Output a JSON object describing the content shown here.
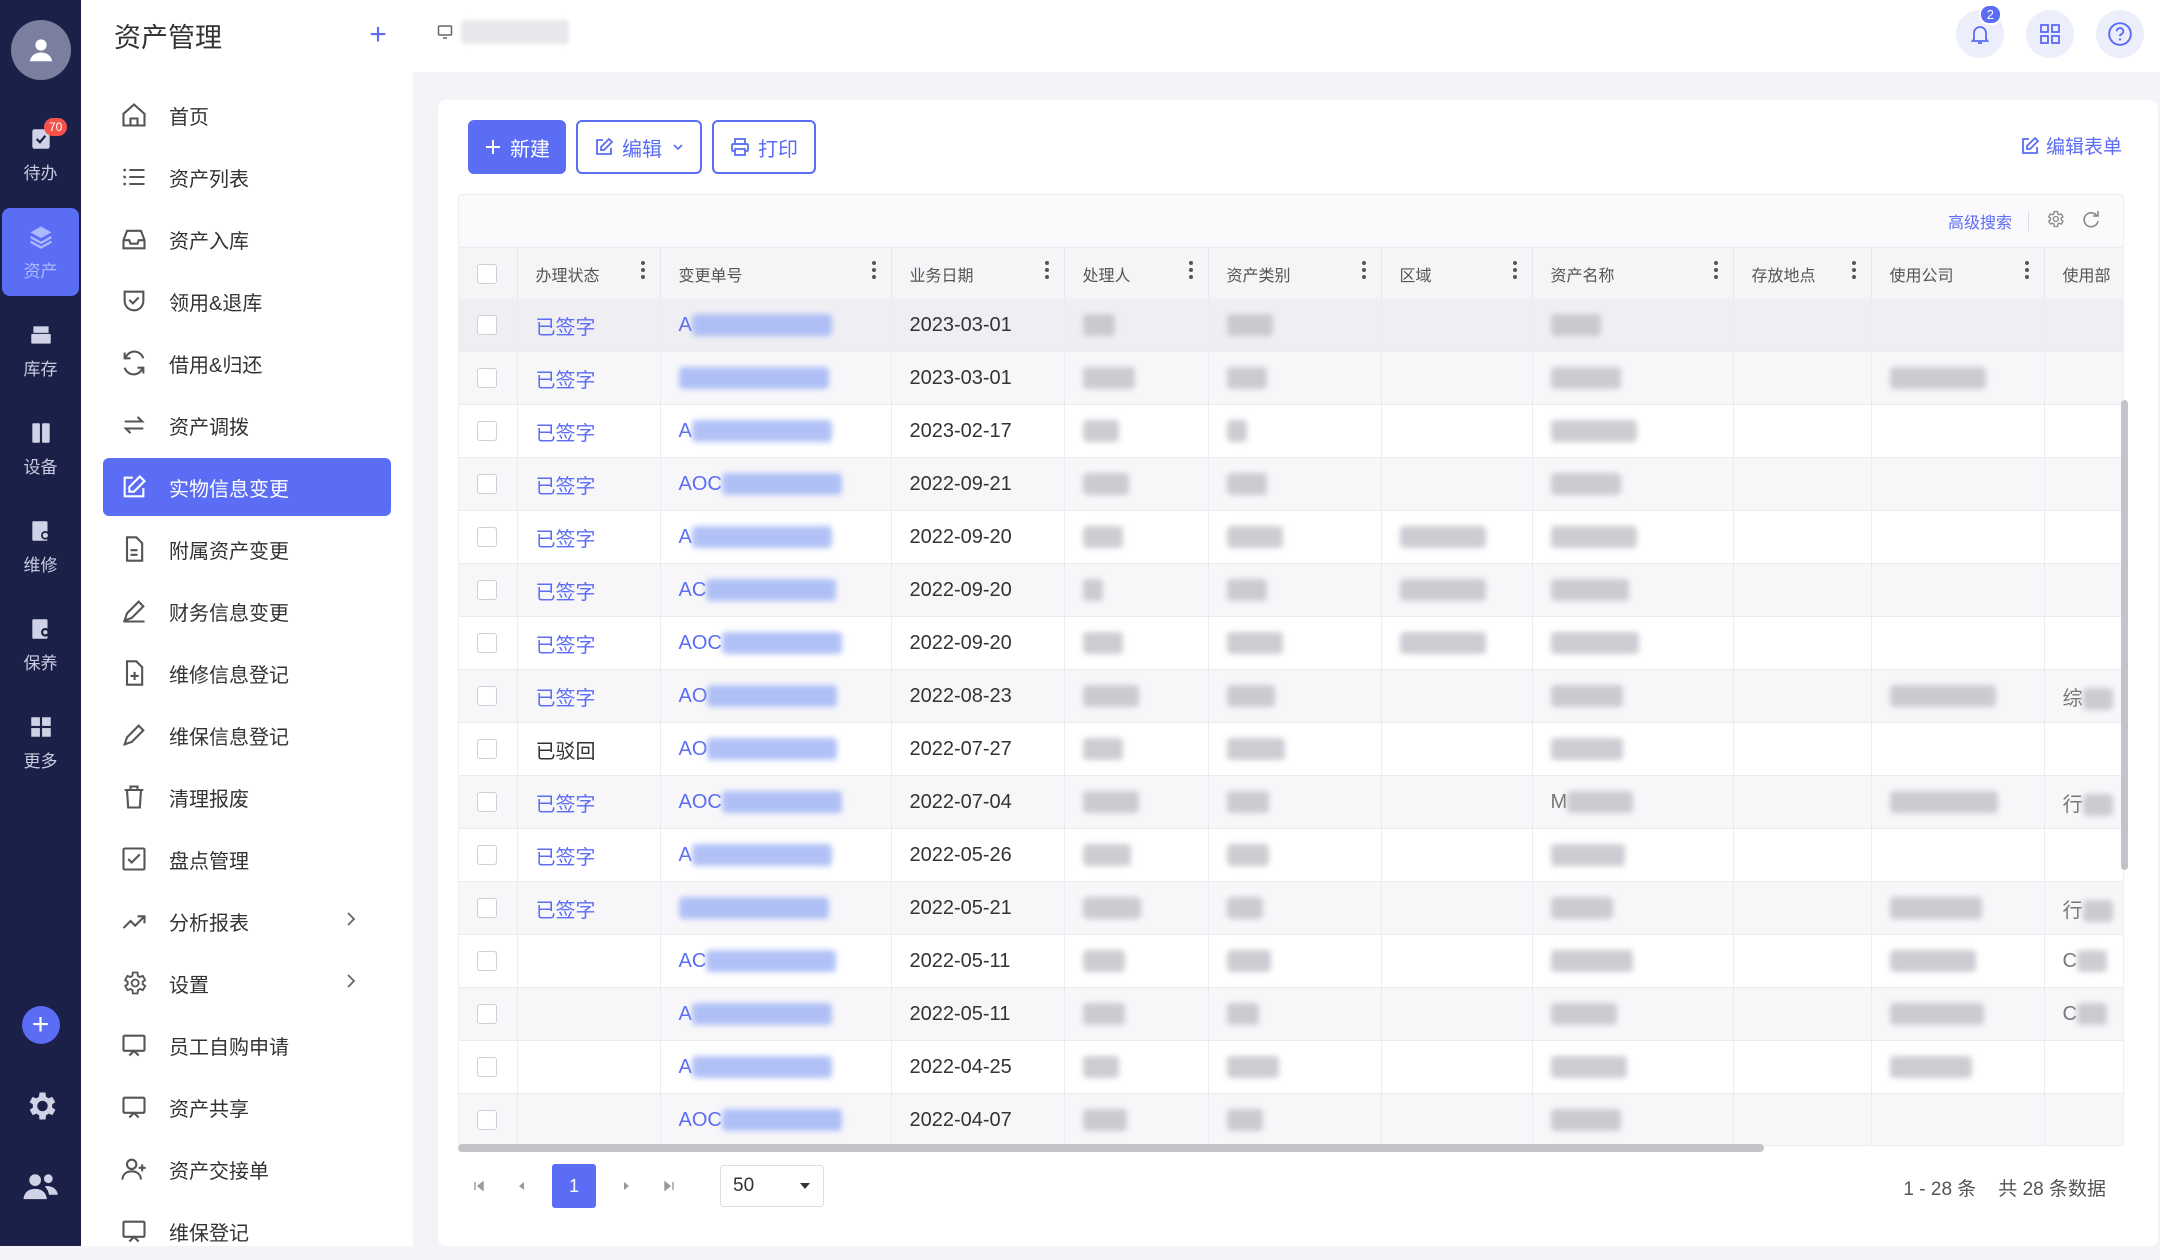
{
  "rail": {
    "items": [
      {
        "label": "待办",
        "badge": "70",
        "icon": "todo-icon"
      },
      {
        "label": "资产",
        "icon": "layers-icon",
        "active": true
      },
      {
        "label": "库存",
        "icon": "inventory-icon"
      },
      {
        "label": "设备",
        "icon": "device-icon"
      },
      {
        "label": "维修",
        "icon": "repair-icon"
      },
      {
        "label": "保养",
        "icon": "maintain-icon"
      },
      {
        "label": "更多",
        "icon": "grid-icon"
      }
    ]
  },
  "sidebar": {
    "title": "资产管理",
    "items": [
      {
        "label": "首页",
        "icon": "home-icon"
      },
      {
        "label": "资产列表",
        "icon": "list-icon"
      },
      {
        "label": "资产入库",
        "icon": "inbox-icon"
      },
      {
        "label": "领用&退库",
        "icon": "shield-check-icon"
      },
      {
        "label": "借用&归还",
        "icon": "refresh-icon"
      },
      {
        "label": "资产调拨",
        "icon": "transfer-icon"
      },
      {
        "label": "实物信息变更",
        "icon": "edit-icon",
        "active": true
      },
      {
        "label": "附属资产变更",
        "icon": "file-icon"
      },
      {
        "label": "财务信息变更",
        "icon": "pen-icon"
      },
      {
        "label": "维修信息登记",
        "icon": "file-plus-icon"
      },
      {
        "label": "维保信息登记",
        "icon": "pencil-icon"
      },
      {
        "label": "清理报废",
        "icon": "trash-icon"
      },
      {
        "label": "盘点管理",
        "icon": "checkbox-icon"
      },
      {
        "label": "分析报表",
        "icon": "trend-icon",
        "expandable": true
      },
      {
        "label": "设置",
        "icon": "gear-icon",
        "expandable": true
      },
      {
        "label": "员工自购申请",
        "icon": "monitor-icon"
      },
      {
        "label": "资产共享",
        "icon": "share-screen-icon"
      },
      {
        "label": "资产交接单",
        "icon": "user-plus-icon"
      },
      {
        "label": "维保登记",
        "icon": "register-icon"
      }
    ]
  },
  "topbar": {
    "notification_count": "2"
  },
  "toolbar": {
    "new_label": "新建",
    "edit_label": "编辑",
    "print_label": "打印",
    "edit_form_label": "编辑表单"
  },
  "table_tools": {
    "advanced_search": "高级搜索"
  },
  "table": {
    "columns": [
      "办理状态",
      "变更单号",
      "业务日期",
      "处理人",
      "资产类别",
      "区域",
      "资产名称",
      "存放地点",
      "使用公司",
      "使用部"
    ],
    "rows": [
      {
        "status": "已签字",
        "doc_prefix": "A",
        "date": "2023-03-01"
      },
      {
        "status": "已签字",
        "doc_prefix": "",
        "date": "2023-03-01"
      },
      {
        "status": "已签字",
        "doc_prefix": "A",
        "date": "2023-02-17"
      },
      {
        "status": "已签字",
        "doc_prefix": "AOC",
        "date": "2022-09-21"
      },
      {
        "status": "已签字",
        "doc_prefix": "A",
        "date": "2022-09-20"
      },
      {
        "status": "已签字",
        "doc_prefix": "AC",
        "date": "2022-09-20"
      },
      {
        "status": "已签字",
        "doc_prefix": "AOC",
        "date": "2022-09-20"
      },
      {
        "status": "已签字",
        "doc_prefix": "AO",
        "date": "2022-08-23"
      },
      {
        "status": "已驳回",
        "doc_prefix": "AO",
        "date": "2022-07-27"
      },
      {
        "status": "已签字",
        "doc_prefix": "AOC",
        "date": "2022-07-04"
      },
      {
        "status": "已签字",
        "doc_prefix": "A",
        "date": "2022-05-26"
      },
      {
        "status": "已签字",
        "doc_prefix": "",
        "date": "2022-05-21"
      },
      {
        "status": "",
        "doc_prefix": "AC",
        "date": "2022-05-11"
      },
      {
        "status": "",
        "doc_prefix": "A",
        "date": "2022-05-11"
      },
      {
        "status": "",
        "doc_prefix": "A",
        "date": "2022-04-25"
      },
      {
        "status": "",
        "doc_prefix": "AOC",
        "date": "2022-04-07"
      }
    ],
    "name_partials": {
      "9": "M"
    },
    "dept_partials": {
      "7": "综",
      "9": "行",
      "11": "行",
      "12": "C",
      "13": "C"
    }
  },
  "pager": {
    "current_page": "1",
    "page_size": "50",
    "range": "1 - 28 条",
    "total": "共 28 条数据"
  },
  "colors": {
    "accent": "#5b6cf5",
    "rail_bg": "#1b2049",
    "badge_red": "#f5524a"
  }
}
